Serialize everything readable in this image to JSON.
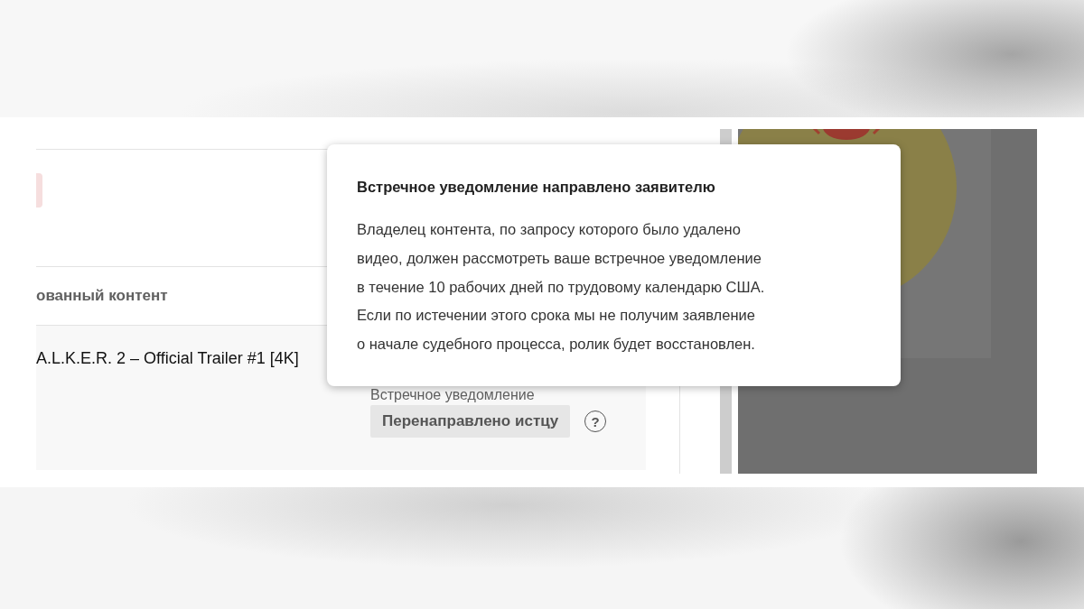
{
  "table": {
    "header": "ованный контент",
    "rows": [
      {
        "title": "A.L.K.E.R. 2 – Official Trailer #1 [4K]",
        "notice_label": "Встречное уведомление",
        "status": "Перенаправлено истцу",
        "help": "?"
      }
    ]
  },
  "tooltip": {
    "title": "Встречное уведомление направлено заявителю",
    "body": "Владелец контента, по запросу которого было удалено\nвидео, должен рассмотреть ваше встречное уведомление\nв течение 10 рабочих дней по трудовому календарю США.\nЕсли по истечении этого срока мы не получим заявление\nо начале судебного процесса, ролик будет восстановлен."
  }
}
